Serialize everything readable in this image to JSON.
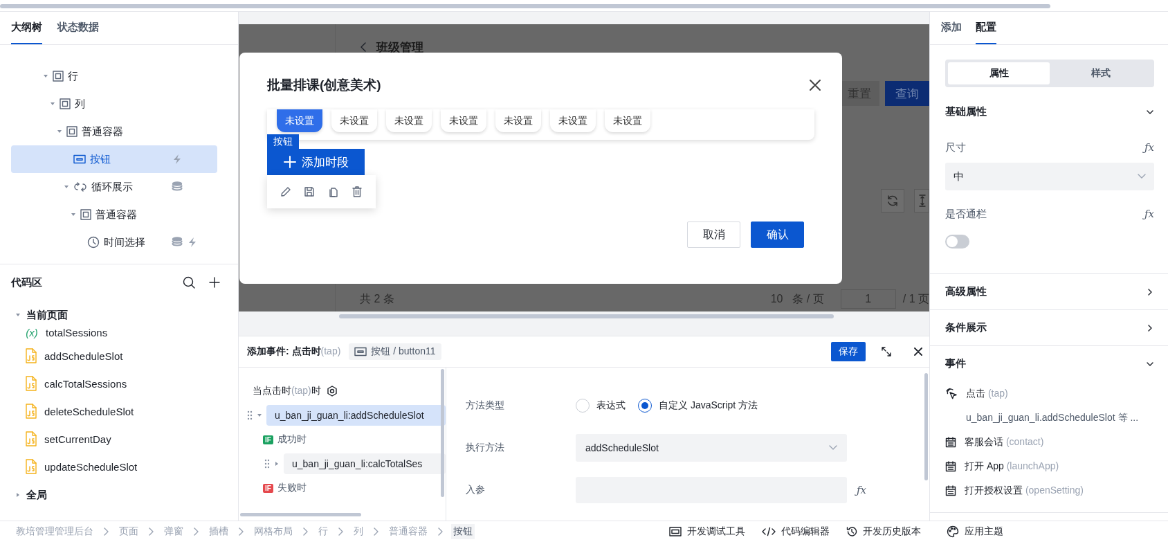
{
  "outline_panel": {
    "tabs": [
      {
        "label": "大纲树",
        "selected": true
      },
      {
        "label": "状态数据",
        "selected": false
      }
    ],
    "tree": [
      {
        "kind": "container",
        "label": "行",
        "selected": false,
        "expanded": true,
        "has_data": false,
        "has_events": false,
        "children": [
          {
            "kind": "container",
            "label": "列",
            "selected": false,
            "expanded": true,
            "has_data": false,
            "has_events": false,
            "children": [
              {
                "kind": "container",
                "label": "普通容器",
                "selected": false,
                "expanded": true,
                "has_data": false,
                "has_events": false,
                "children": [
                  {
                    "kind": "button",
                    "label": "按钮",
                    "selected": true,
                    "has_data": false,
                    "has_events": true
                  },
                  {
                    "kind": "loop",
                    "label": "循环展示",
                    "selected": false,
                    "expanded": true,
                    "has_data": true,
                    "has_events": false,
                    "children": [
                      {
                        "kind": "container",
                        "label": "普通容器",
                        "selected": false,
                        "expanded": true,
                        "has_data": false,
                        "has_events": false,
                        "children": [
                          {
                            "kind": "clock",
                            "label": "时间选择",
                            "selected": false,
                            "has_data": true,
                            "has_events": true
                          }
                        ]
                      }
                    ]
                  }
                ]
              }
            ]
          }
        ]
      }
    ]
  },
  "code_panel": {
    "title": "代码区",
    "groups": [
      {
        "label": "当前页面",
        "expanded": true,
        "items": [
          {
            "kind": "variable",
            "symbol": "(x)",
            "label": "totalSessions"
          },
          {
            "kind": "js",
            "label": "addScheduleSlot"
          },
          {
            "kind": "js",
            "label": "calcTotalSessions"
          },
          {
            "kind": "js",
            "label": "deleteScheduleSlot"
          },
          {
            "kind": "js",
            "label": "setCurrentDay"
          },
          {
            "kind": "js",
            "label": "updateScheduleSlot"
          }
        ]
      },
      {
        "label": "全局",
        "expanded": false
      }
    ]
  },
  "canvas": {
    "page_title": "班级管理",
    "filter_buttons": [
      {
        "kind": "plain",
        "label": "重置"
      },
      {
        "kind": "primary",
        "label": "查询"
      }
    ],
    "pagination": {
      "total": "共 2 条",
      "page_size": "10",
      "per_page": "条 / 页",
      "page": "1",
      "pages": "/ 1 页"
    }
  },
  "modal": {
    "title": "批量排课(创意美术)",
    "day_chips": [
      {
        "label": "未设置",
        "selected": true
      },
      {
        "label": "未设置",
        "selected": false
      },
      {
        "label": "未设置",
        "selected": false
      },
      {
        "label": "未设置",
        "selected": false
      },
      {
        "label": "未设置",
        "selected": false
      },
      {
        "label": "未设置",
        "selected": false
      },
      {
        "label": "未设置",
        "selected": false
      }
    ],
    "selection_tag": "按钮",
    "add_button": "添加时段",
    "cancel": "取消",
    "confirm": "确认"
  },
  "event_panel": {
    "title": "添加事件: 点击时",
    "title_hint": "(tap)",
    "target": "按钮 / button11",
    "save": "保存",
    "trigger": {
      "before": "当点击时",
      "hint": "(tap)",
      "after": "时"
    },
    "actions": [
      {
        "label": "u_ban_ji_guan_li:addScheduleSlot",
        "selected": true,
        "expanded": true,
        "branches": [
          {
            "kind": "success",
            "badge": "IF",
            "label": "成功时",
            "actions": [
              {
                "label": "u_ban_ji_guan_li:calcTotalSes",
                "selected": false,
                "expanded": false
              }
            ]
          },
          {
            "kind": "failure",
            "badge": "IF",
            "label": "失败时"
          }
        ]
      }
    ],
    "form": {
      "method_type": {
        "label": "方法类型",
        "options": [
          {
            "label": "表达式",
            "selected": false
          },
          {
            "label": "自定义 JavaScript 方法",
            "selected": true
          }
        ]
      },
      "method": {
        "label": "执行方法",
        "value": "addScheduleSlot"
      },
      "params": {
        "label": "入参",
        "formula": "ƒx"
      }
    }
  },
  "config_panel": {
    "tabs": [
      {
        "label": "添加",
        "selected": false
      },
      {
        "label": "配置",
        "selected": true
      }
    ],
    "segments": [
      {
        "label": "属性",
        "selected": true
      },
      {
        "label": "样式",
        "selected": false
      }
    ],
    "sections": [
      {
        "kind": "fields",
        "title": "基础属性",
        "expanded": true,
        "fields": [
          {
            "kind": "select",
            "label": "尺寸",
            "formula": "ƒx",
            "value": "中"
          },
          {
            "kind": "toggle",
            "label": "是否通栏",
            "formula": "ƒx",
            "on": false
          }
        ]
      },
      {
        "title": "高级属性",
        "expanded": false
      },
      {
        "title": "条件展示",
        "expanded": false
      },
      {
        "kind": "events",
        "title": "事件",
        "expanded": true,
        "events": [
          {
            "kind": "tap",
            "label": "点击",
            "code": "(tap)",
            "detail": "u_ban_ji_guan_li.addScheduleSlot 等 ..."
          },
          {
            "kind": "other",
            "label": "客服会话",
            "code": "(contact)"
          },
          {
            "kind": "other",
            "label": "打开 App",
            "code": "(launchApp)"
          },
          {
            "kind": "other",
            "label": "打开授权设置",
            "code": "(openSetting)"
          }
        ]
      }
    ]
  },
  "status_bar": {
    "breadcrumb": [
      {
        "label": "教培管理管理后台",
        "selected": false
      },
      {
        "label": "页面",
        "selected": false
      },
      {
        "label": "弹窗",
        "selected": false
      },
      {
        "label": "插槽",
        "selected": false
      },
      {
        "label": "网格布局",
        "selected": false
      },
      {
        "label": "行",
        "selected": false
      },
      {
        "label": "列",
        "selected": false
      },
      {
        "label": "普通容器",
        "selected": false
      },
      {
        "label": "按钮",
        "selected": true
      }
    ],
    "tools": [
      {
        "kind": "debug",
        "label": "开发调试工具"
      },
      {
        "kind": "code",
        "label": "代码编辑器"
      },
      {
        "kind": "history",
        "label": "开发历史版本"
      }
    ],
    "theme": {
      "kind": "theme",
      "label": "应用主题"
    }
  }
}
